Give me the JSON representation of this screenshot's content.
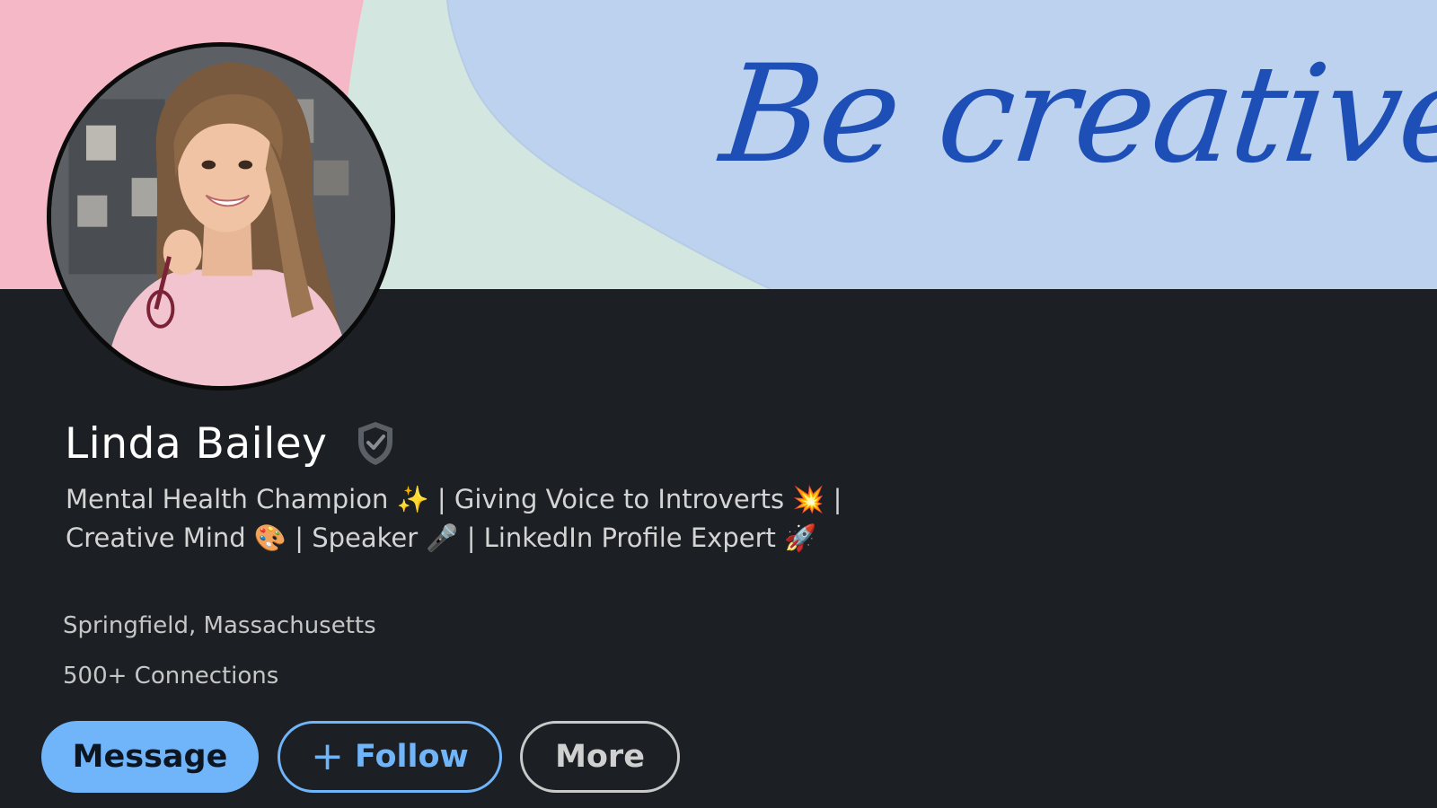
{
  "banner": {
    "text": "Be creative",
    "text_color": "#1d4fb6",
    "colors": {
      "pink": "#f4b8c6",
      "mint": "#d3e6df",
      "blue": "#bdd2ee"
    }
  },
  "avatar": {
    "icon": "profile-photo",
    "border_color": "#0a0a0a"
  },
  "profile": {
    "name": "Linda Bailey",
    "verified_icon": "shield-check-icon",
    "headline": "Mental Health Champion ✨ | Giving Voice to Introverts 💥 | Creative Mind 🎨 | Speaker 🎤 | LinkedIn Profile Expert 🚀",
    "location": "Springfield, Massachusetts",
    "connections": "500+ Connections"
  },
  "actions": {
    "message_label": "Message",
    "follow_label": "Follow",
    "follow_icon": "+",
    "more_label": "More",
    "accent_color": "#70b5f9"
  },
  "theme": {
    "background": "#1c1f23",
    "text_primary": "#ffffff",
    "text_secondary": "#c6c6c6"
  }
}
